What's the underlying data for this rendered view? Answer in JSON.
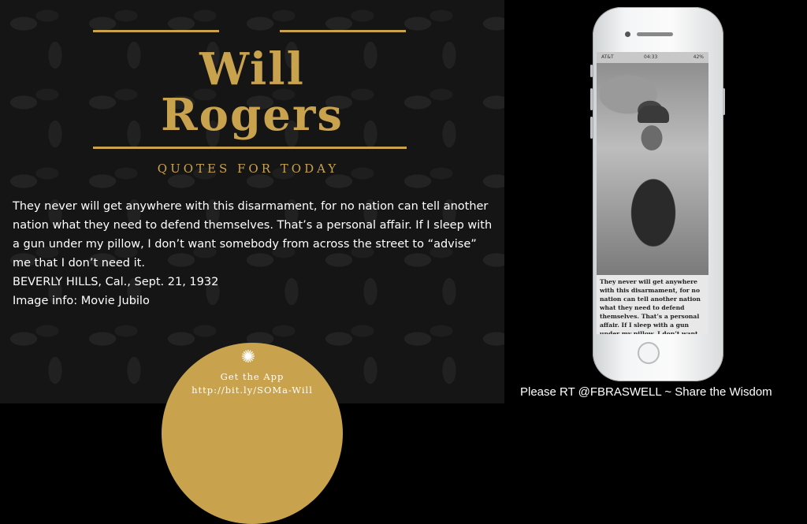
{
  "title": {
    "line1": "Will",
    "line2": "Rogers",
    "subtitle": "QUOTES FOR TODAY"
  },
  "quote": {
    "text": "They never will get anywhere with this disarmament, for no nation can tell another nation what they need to defend themselves. That’s a personal affair. If I sleep with a gun under my pillow, I don’t want somebody from across the street to “advise” me that I don’t need it.",
    "source": "BEVERLY HILLS, Cal., Sept. 21, 1932",
    "image_info": "Image info: Movie Jubilo"
  },
  "app_badge": {
    "icon": "mandala-icon",
    "line1": "Get the App",
    "line2": "http://bit.ly/SOMa-Will"
  },
  "phone": {
    "carrier": "AT&T",
    "time": "04:33",
    "battery": "42%",
    "screen_text": "They never will get anywhere with this disarmament, for no nation can tell another nation what they need to defend themselves. That’s a personal affair. If I sleep with a gun under my pillow, I don’t want somebody from"
  },
  "footer": {
    "cta": "Please RT @FBRASWELL ~ Share the  Wisdom"
  },
  "colors": {
    "gold": "#c9a24e",
    "background": "#151515"
  }
}
